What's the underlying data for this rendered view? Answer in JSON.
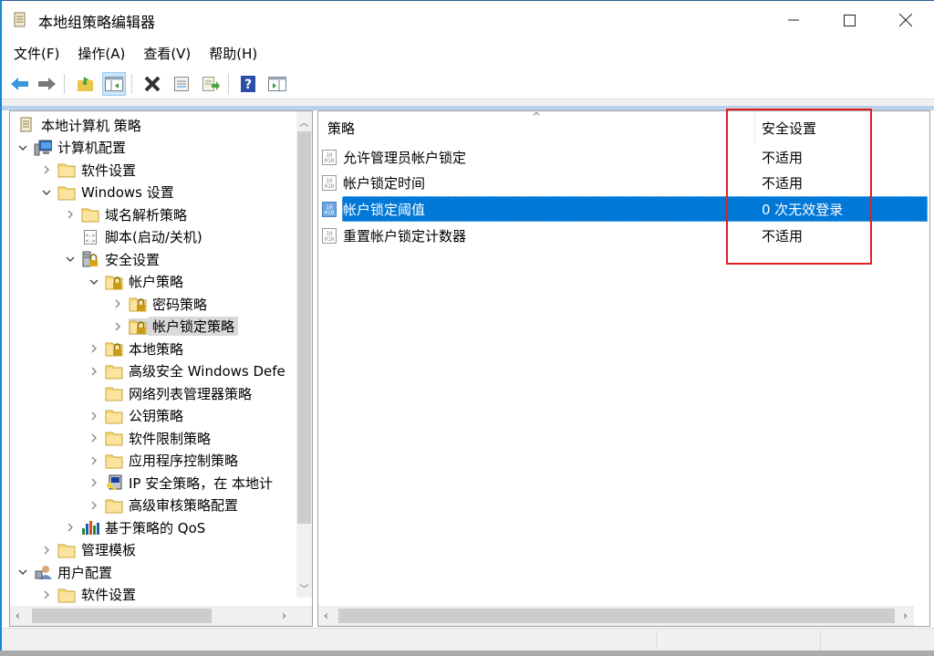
{
  "window": {
    "title": "本地组策略编辑器",
    "controls": {
      "minimize": "—",
      "maximize": "☐",
      "close": "✕"
    }
  },
  "menu": [
    "文件(F)",
    "操作(A)",
    "查看(V)",
    "帮助(H)"
  ],
  "toolbar": {
    "buttons": [
      "back-arrow",
      "forward-arrow",
      "up-folder",
      "show-hide-tree",
      "delete",
      "properties",
      "export-list",
      "help",
      "show-hide-action-pane"
    ]
  },
  "tree": {
    "items": [
      {
        "label": "本地计算机 策略",
        "icon": "policy-scroll-icon",
        "expander": "",
        "level": 0
      },
      {
        "label": "计算机配置",
        "icon": "computer-icon",
        "expander": "expanded",
        "level": 0
      },
      {
        "label": "软件设置",
        "icon": "folder-icon",
        "expander": "collapsed",
        "level": 1
      },
      {
        "label": "Windows 设置",
        "icon": "folder-icon",
        "expander": "expanded",
        "level": 1
      },
      {
        "label": "域名解析策略",
        "icon": "folder-icon",
        "expander": "collapsed",
        "level": 2
      },
      {
        "label": "脚本(启动/关机)",
        "icon": "script-icon",
        "expander": "",
        "level": 2
      },
      {
        "label": "安全设置",
        "icon": "security-server-icon",
        "expander": "expanded",
        "level": 2
      },
      {
        "label": "帐户策略",
        "icon": "locked-folder-icon",
        "expander": "expanded",
        "level": 3
      },
      {
        "label": "密码策略",
        "icon": "locked-folder-icon",
        "expander": "collapsed",
        "level": 4
      },
      {
        "label": "帐户锁定策略",
        "icon": "locked-folder-icon",
        "expander": "collapsed",
        "level": 4,
        "selected": true
      },
      {
        "label": "本地策略",
        "icon": "locked-folder-icon",
        "expander": "collapsed",
        "level": 3
      },
      {
        "label": "高级安全 Windows Defe",
        "icon": "folder-icon",
        "expander": "collapsed",
        "level": 3
      },
      {
        "label": "网络列表管理器策略",
        "icon": "folder-icon",
        "expander": "",
        "level": 3
      },
      {
        "label": "公钥策略",
        "icon": "folder-icon",
        "expander": "collapsed",
        "level": 3
      },
      {
        "label": "软件限制策略",
        "icon": "folder-icon",
        "expander": "collapsed",
        "level": 3
      },
      {
        "label": "应用程序控制策略",
        "icon": "folder-icon",
        "expander": "collapsed",
        "level": 3
      },
      {
        "label": "IP 安全策略，在 本地计",
        "icon": "ip-security-icon",
        "expander": "collapsed",
        "level": 3
      },
      {
        "label": "高级审核策略配置",
        "icon": "folder-icon",
        "expander": "collapsed",
        "level": 3
      },
      {
        "label": "基于策略的 QoS",
        "icon": "qos-chart-icon",
        "expander": "collapsed",
        "level": 2
      },
      {
        "label": "管理模板",
        "icon": "folder-icon",
        "expander": "collapsed",
        "level": 1
      },
      {
        "label": "用户配置",
        "icon": "user-icon",
        "expander": "expanded",
        "level": 0
      },
      {
        "label": "软件设置",
        "icon": "folder-icon",
        "expander": "collapsed",
        "level": 1
      }
    ]
  },
  "list": {
    "columns": [
      "策略",
      "安全设置"
    ],
    "rows": [
      {
        "policy": "允许管理员帐户锁定",
        "setting": "不适用"
      },
      {
        "policy": "帐户锁定时间",
        "setting": "不适用"
      },
      {
        "policy": "帐户锁定阈值",
        "setting": "0 次无效登录",
        "selected": true
      },
      {
        "policy": "重置帐户锁定计数器",
        "setting": "不适用"
      }
    ]
  },
  "colors": {
    "selection": "#0078d7",
    "highlight_box": "#e02020",
    "tree_selection": "#d9d9d9"
  }
}
